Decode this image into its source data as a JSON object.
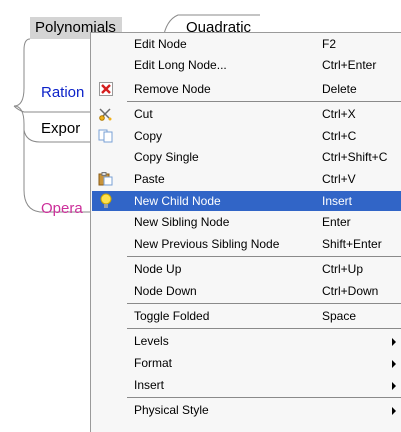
{
  "mindmap": {
    "nodes": {
      "polynomials": "Polynomials",
      "quadratic": "Quadratic",
      "rational": "Ration",
      "exponent": "Expor",
      "operations": "Opera"
    }
  },
  "context_menu": {
    "items": [
      {
        "label": "Edit Node",
        "shortcut": "F2"
      },
      {
        "label": "Edit Long Node...",
        "shortcut": "Ctrl+Enter"
      },
      {
        "label": "Remove Node",
        "shortcut": "Delete",
        "icon": "remove-icon"
      },
      {
        "label": "Cut",
        "shortcut": "Ctrl+X",
        "icon": "scissors-icon"
      },
      {
        "label": "Copy",
        "shortcut": "Ctrl+C",
        "icon": "copy-icon"
      },
      {
        "label": "Copy Single",
        "shortcut": "Ctrl+Shift+C"
      },
      {
        "label": "Paste",
        "shortcut": "Ctrl+V",
        "icon": "paste-icon"
      },
      {
        "label": "New Child Node",
        "shortcut": "Insert",
        "icon": "lightbulb-icon",
        "highlighted": true
      },
      {
        "label": "New Sibling Node",
        "shortcut": "Enter"
      },
      {
        "label": "New Previous Sibling Node",
        "shortcut": "Shift+Enter"
      },
      {
        "label": "Node Up",
        "shortcut": "Ctrl+Up"
      },
      {
        "label": "Node Down",
        "shortcut": "Ctrl+Down"
      },
      {
        "label": "Toggle Folded",
        "shortcut": "Space"
      },
      {
        "label": "Levels",
        "submenu": true
      },
      {
        "label": "Format",
        "submenu": true
      },
      {
        "label": "Insert",
        "submenu": true
      },
      {
        "label": "Physical Style",
        "submenu": true
      }
    ]
  },
  "colors": {
    "highlight": "#3165c7",
    "rational_node": "#0d23c9",
    "operations_node": "#cc2f9a",
    "menu_background": "#f7f7f7"
  }
}
